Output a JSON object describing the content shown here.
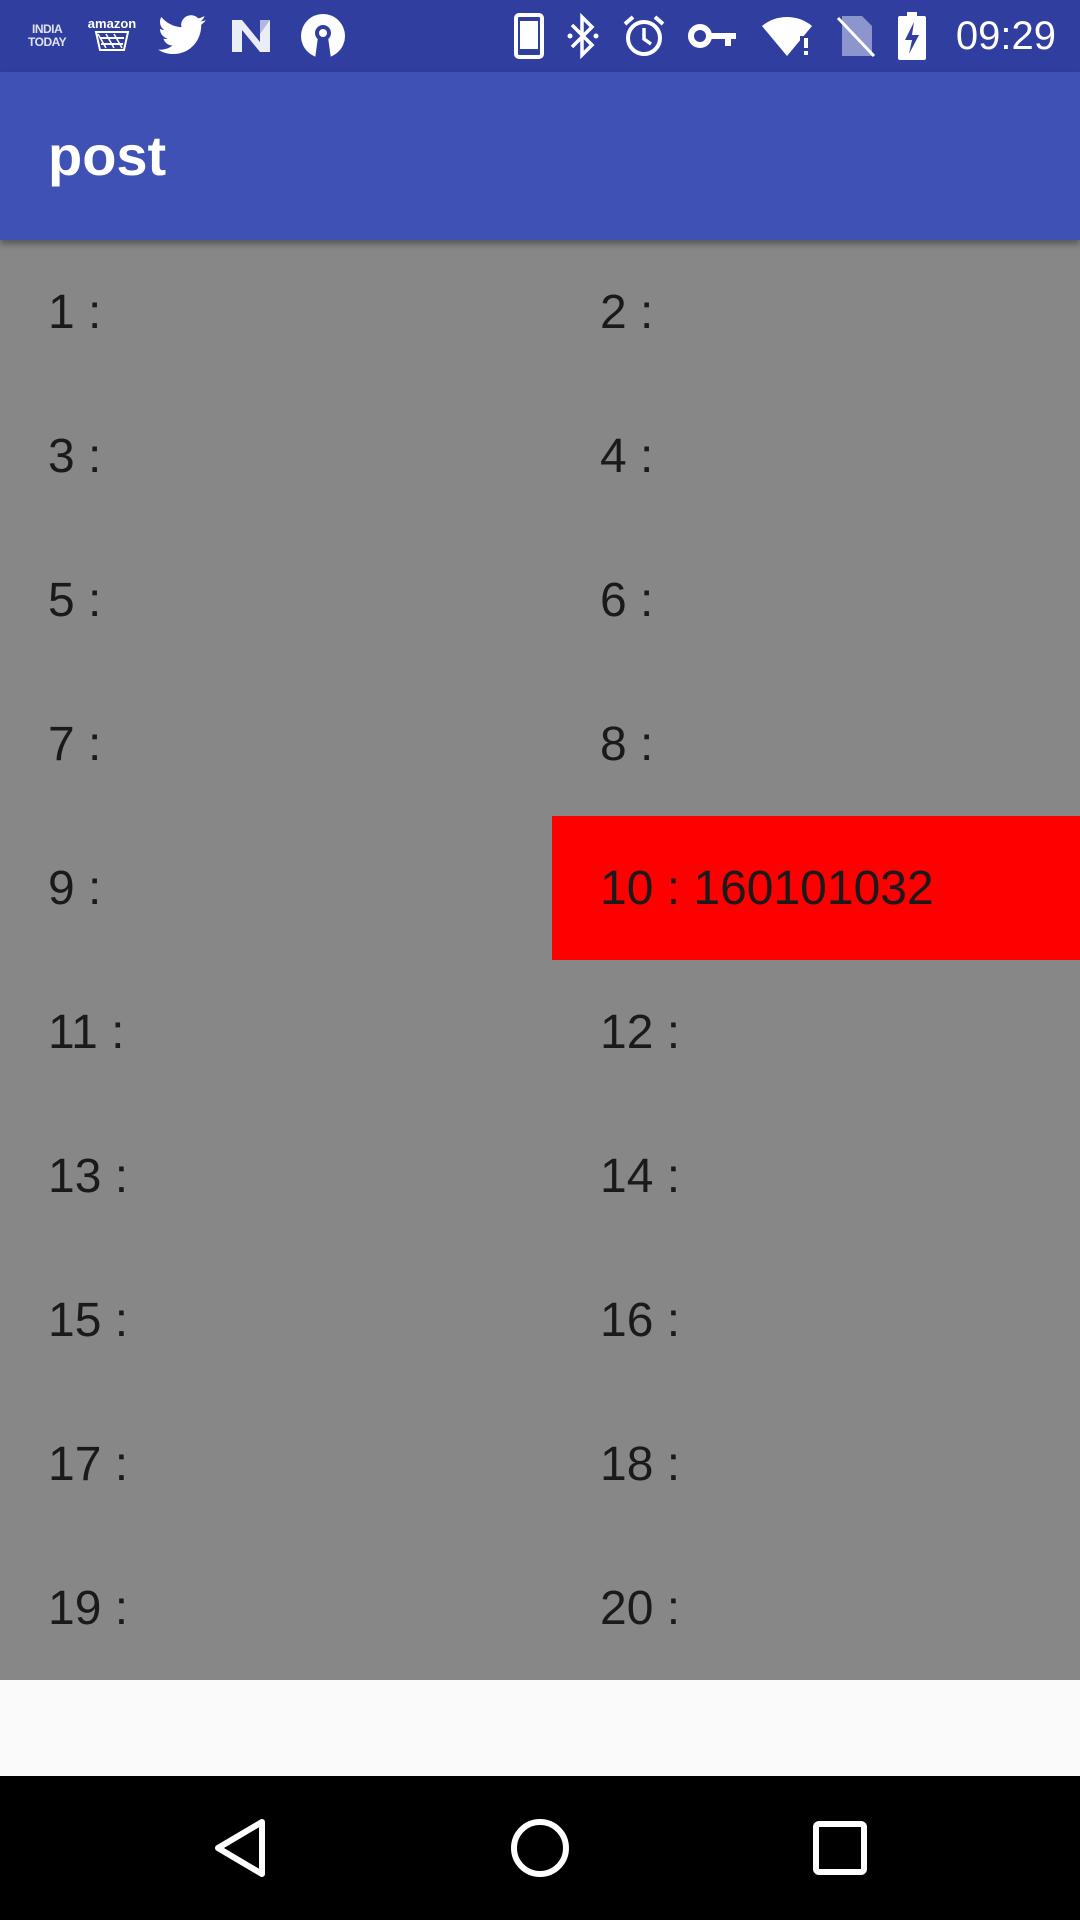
{
  "status_bar": {
    "time": "09:29",
    "left_icons": [
      {
        "name": "india-today-icon",
        "text": "INDIA TODAY"
      },
      {
        "name": "amazon-icon",
        "text": "amazon"
      },
      {
        "name": "twitter-icon"
      },
      {
        "name": "news-n-icon"
      },
      {
        "name": "keyhole-icon"
      }
    ],
    "right_icons": [
      "phone-icon",
      "bluetooth-icon",
      "alarm-icon",
      "vpn-key-icon",
      "wifi-icon",
      "no-sim-icon",
      "battery-charging-icon"
    ]
  },
  "app_bar": {
    "title": "post"
  },
  "grid": {
    "rows": [
      [
        {
          "label": "1 :"
        },
        {
          "label": "2 :"
        }
      ],
      [
        {
          "label": "3 :"
        },
        {
          "label": "4 :"
        }
      ],
      [
        {
          "label": "5 :"
        },
        {
          "label": "6 :"
        }
      ],
      [
        {
          "label": "7 :"
        },
        {
          "label": "8 :"
        }
      ],
      [
        {
          "label": "9 :"
        },
        {
          "label": "10 : 160101032",
          "highlight": true
        }
      ],
      [
        {
          "label": "11 :"
        },
        {
          "label": "12 :"
        }
      ],
      [
        {
          "label": "13 :"
        },
        {
          "label": "14 :"
        }
      ],
      [
        {
          "label": "15 :"
        },
        {
          "label": "16 :"
        }
      ],
      [
        {
          "label": "17 :"
        },
        {
          "label": "18 :"
        }
      ],
      [
        {
          "label": "19 :"
        },
        {
          "label": "20 :"
        }
      ]
    ]
  },
  "nav_bar": {
    "buttons": [
      "back-icon",
      "home-icon",
      "recents-icon"
    ]
  },
  "colors": {
    "status_bar": "#303f9f",
    "app_bar": "#3f51b5",
    "grid_background": "#878787",
    "highlight": "#ff0000"
  }
}
